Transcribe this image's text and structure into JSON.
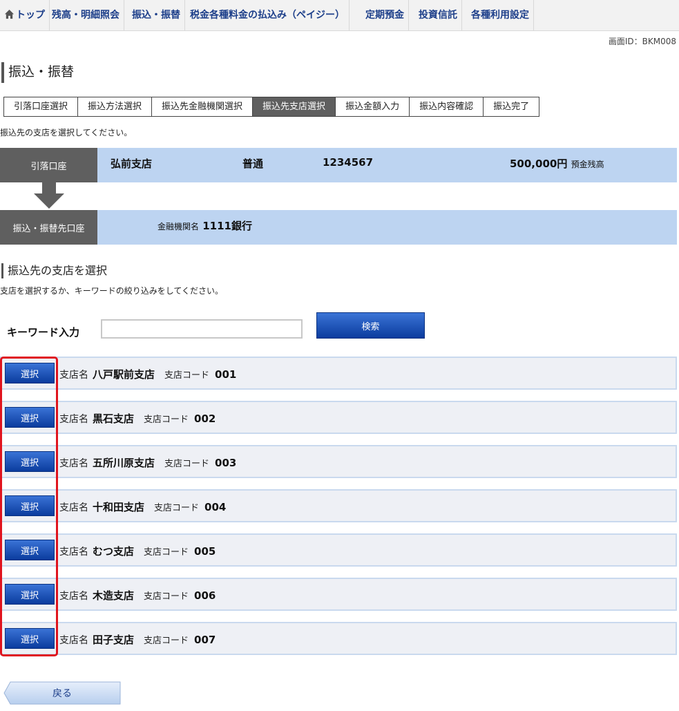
{
  "nav": {
    "items": [
      {
        "label": "トップ"
      },
      {
        "label": "残高・明細照会"
      },
      {
        "label": "振込・振替"
      },
      {
        "label": "税金各種料金の払込み（ペイジー）"
      },
      {
        "label": "定期預金"
      },
      {
        "label": "投資信託"
      },
      {
        "label": "各種利用設定"
      }
    ]
  },
  "screen_id": "画面ID：BKM008",
  "page_title": "振込・振替",
  "steps": [
    {
      "label": "引落口座選択",
      "active": false
    },
    {
      "label": "振込方法選択",
      "active": false
    },
    {
      "label": "振込先金融機関選択",
      "active": false
    },
    {
      "label": "振込先支店選択",
      "active": true
    },
    {
      "label": "振込金額入力",
      "active": false
    },
    {
      "label": "振込内容確認",
      "active": false
    },
    {
      "label": "振込完了",
      "active": false
    }
  ],
  "instruction": "振込先の支店を選択してください。",
  "debit_account": {
    "label": "引落口座",
    "branch": "弘前支店",
    "type": "普通",
    "number": "1234567",
    "balance": "500,000円",
    "balance_label": "預金残高"
  },
  "transfer_account": {
    "label": "振込・振替先口座",
    "bank_label": "金融機関名",
    "bank_name": "1111銀行"
  },
  "branch_section": {
    "title": "振込先の支店を選択",
    "instruction": "支店を選択するか、キーワードの絞り込みをしてください。",
    "keyword_label": "キーワード入力",
    "keyword_value": "",
    "search_label": "検索",
    "select_label": "選択",
    "name_label": "支店名",
    "code_label": "支店コード",
    "branches": [
      {
        "name": "八戸駅前支店",
        "code": "001"
      },
      {
        "name": "黒石支店",
        "code": "002"
      },
      {
        "name": "五所川原支店",
        "code": "003"
      },
      {
        "name": "十和田支店",
        "code": "004"
      },
      {
        "name": "むつ支店",
        "code": "005"
      },
      {
        "name": "木造支店",
        "code": "006"
      },
      {
        "name": "田子支店",
        "code": "007"
      }
    ]
  },
  "back_label": "戻る",
  "colors": {
    "nav_text": "#1d3f8a",
    "button_blue": "#0b3c9e",
    "panel_blue": "#bdd4f1",
    "label_gray": "#5f5f5f",
    "highlight_red": "#e0141e"
  }
}
